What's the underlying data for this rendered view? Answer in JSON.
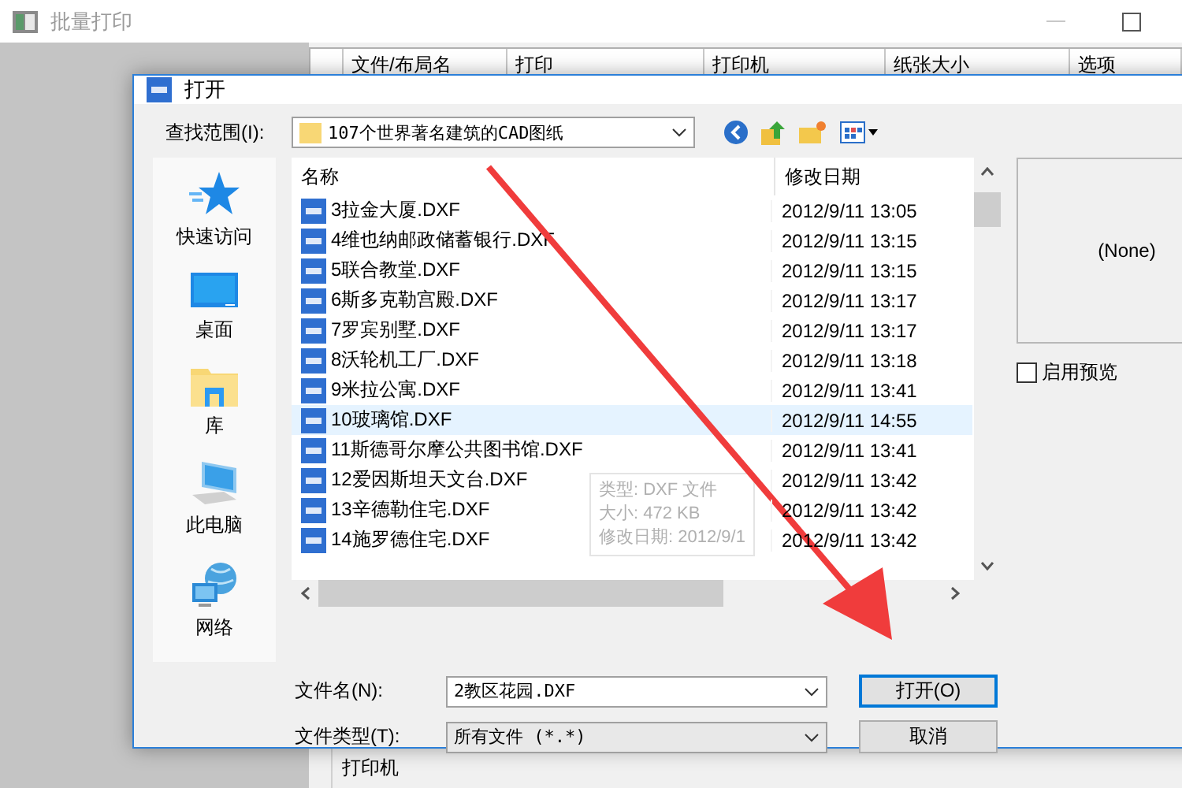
{
  "window": {
    "title": "批量打印"
  },
  "table": {
    "columns": [
      "文件/布局名",
      "打印",
      "打印机",
      "纸张大小",
      "选项"
    ]
  },
  "printer_group": {
    "title": "打印机"
  },
  "dialog": {
    "title": "打开",
    "look_in": {
      "label": "查找范围(I):",
      "value": "107个世界著名建筑的CAD图纸"
    },
    "places": [
      {
        "label": "快速访问",
        "kind": "star"
      },
      {
        "label": "桌面",
        "kind": "desktop"
      },
      {
        "label": "库",
        "kind": "library"
      },
      {
        "label": "此电脑",
        "kind": "computer"
      },
      {
        "label": "网络",
        "kind": "network"
      }
    ],
    "list": {
      "columns": [
        "名称",
        "修改日期"
      ],
      "files": [
        {
          "name": "3拉金大厦.DXF",
          "modified": "2012/9/11 13:05",
          "selected": false
        },
        {
          "name": "4维也纳邮政储蓄银行.DXF",
          "modified": "2012/9/11 13:15",
          "selected": false
        },
        {
          "name": "5联合教堂.DXF",
          "modified": "2012/9/11 13:15",
          "selected": false
        },
        {
          "name": "6斯多克勒宫殿.DXF",
          "modified": "2012/9/11 13:17",
          "selected": false
        },
        {
          "name": "7罗宾别墅.DXF",
          "modified": "2012/9/11 13:17",
          "selected": false
        },
        {
          "name": "8沃轮机工厂.DXF",
          "modified": "2012/9/11 13:18",
          "selected": false
        },
        {
          "name": "9米拉公寓.DXF",
          "modified": "2012/9/11 13:41",
          "selected": false
        },
        {
          "name": "10玻璃馆.DXF",
          "modified": "2012/9/11 14:55",
          "selected": true
        },
        {
          "name": "11斯德哥尔摩公共图书馆.DXF",
          "modified": "2012/9/11 13:41",
          "selected": false
        },
        {
          "name": "12爱因斯坦天文台.DXF",
          "modified": "2012/9/11 13:42",
          "selected": false
        },
        {
          "name": "13辛德勒住宅.DXF",
          "modified": "2012/9/11 13:42",
          "selected": false
        },
        {
          "name": "14施罗德住宅.DXF",
          "modified": "2012/9/11 13:42",
          "selected": false
        }
      ]
    },
    "tooltip": [
      "类型: DXF 文件",
      "大小: 472 KB",
      "修改日期: 2012/9/1"
    ],
    "preview": {
      "text": "(None)",
      "checkbox": {
        "label": "启用预览",
        "checked": false
      }
    },
    "file_name": {
      "label": "文件名(N):",
      "value": "2教区花园.DXF"
    },
    "file_type": {
      "label": "文件类型(T):",
      "value": "所有文件 (*.*)"
    },
    "buttons": [
      {
        "label": "打开(O)",
        "default": true
      },
      {
        "label": "取消",
        "default": false
      }
    ]
  }
}
